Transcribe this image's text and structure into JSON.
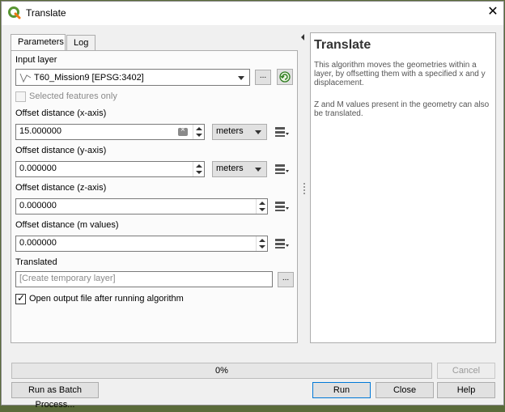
{
  "window": {
    "title": "Translate"
  },
  "tabs": [
    {
      "label": "Parameters"
    },
    {
      "label": "Log"
    }
  ],
  "params": {
    "input_layer_label": "Input layer",
    "input_layer_value": "T60_Mission9 [EPSG:3402]",
    "browse_label": "...",
    "selected_only_label": "Selected features only",
    "offset_x_label": "Offset distance (x-axis)",
    "offset_x_value": "15.000000",
    "offset_x_unit": "meters",
    "offset_y_label": "Offset distance (y-axis)",
    "offset_y_value": "0.000000",
    "offset_y_unit": "meters",
    "offset_z_label": "Offset distance (z-axis)",
    "offset_z_value": "0.000000",
    "offset_m_label": "Offset distance (m values)",
    "offset_m_value": "0.000000",
    "translated_label": "Translated",
    "translated_placeholder": "[Create temporary layer]",
    "open_output_label": "Open output file after running algorithm"
  },
  "help": {
    "title": "Translate",
    "p1": "This algorithm moves the geometries within a layer, by offsetting them with a specified x and y displacement.",
    "p2": "Z and M values present in the geometry can also be translated."
  },
  "progress": {
    "text": "0%"
  },
  "buttons": {
    "cancel": "Cancel",
    "batch": "Run as Batch Process...",
    "run": "Run",
    "close": "Close",
    "help": "Help"
  },
  "colors": {
    "qgis_green": "#589632",
    "qgis_yellow": "#ee7913",
    "primary_border": "#0078d7"
  }
}
